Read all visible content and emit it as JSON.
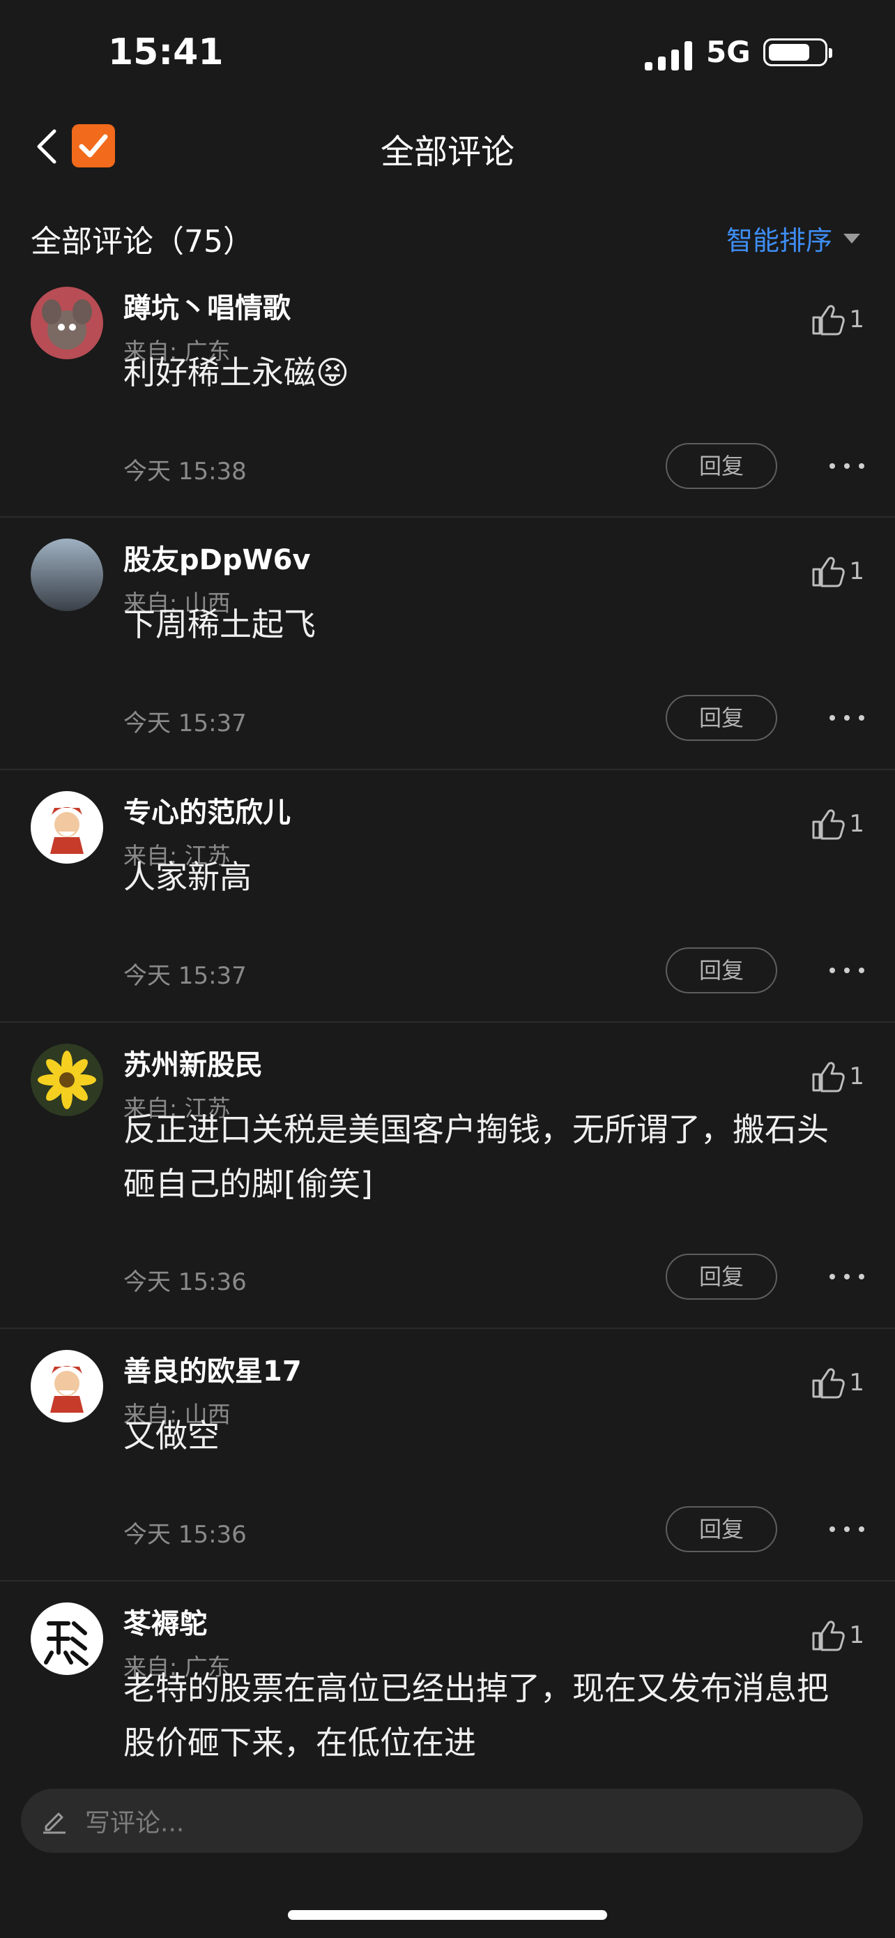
{
  "status": {
    "time": "15:41",
    "network": "5G"
  },
  "nav": {
    "title": "全部评论"
  },
  "section": {
    "title": "全部评论（75）",
    "sort_label": "智能排序"
  },
  "comments": [
    {
      "user": "蹲坑丶唱情歌",
      "origin": "来自: 广东",
      "likes": "1",
      "text": "利好稀土永磁😝",
      "time": "今天 15:38",
      "reply": "回复"
    },
    {
      "user": "股友pDpW6v",
      "origin": "来自: 山西",
      "likes": "1",
      "text": "下周稀土起飞",
      "time": "今天 15:37",
      "reply": "回复"
    },
    {
      "user": "专心的范欣儿",
      "origin": "来自: 江苏",
      "likes": "1",
      "text": "人家新高",
      "time": "今天 15:37",
      "reply": "回复"
    },
    {
      "user": "苏州新股民",
      "origin": "来自: 江苏",
      "likes": "1",
      "text": "反正进口关税是美国客户掏钱，无所谓了，搬石头砸自己的脚[偷笑]",
      "time": "今天 15:36",
      "reply": "回复"
    },
    {
      "user": "善良的欧星17",
      "origin": "来自: 山西",
      "likes": "1",
      "text": "又做空",
      "time": "今天 15:36",
      "reply": "回复"
    },
    {
      "user": "苳褥鸵",
      "origin": "来自: 广东",
      "likes": "1",
      "text": "老特的股票在高位已经出掉了，现在又发布消息把股价砸下来，在低位在进",
      "time": "",
      "reply": ""
    }
  ],
  "composer": {
    "placeholder": "写评论..."
  }
}
